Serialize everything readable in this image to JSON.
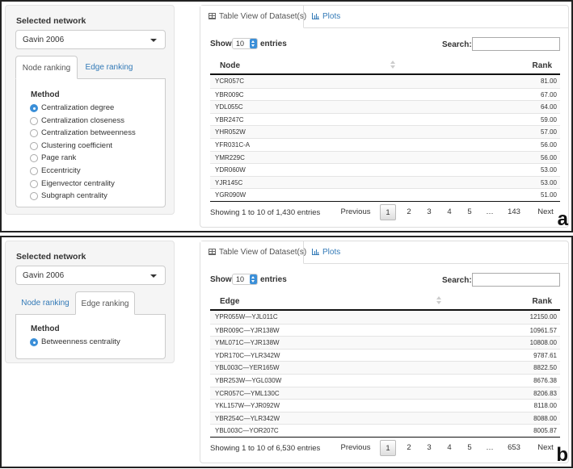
{
  "panel_a": {
    "letter": "a",
    "sidebar": {
      "network_label": "Selected network",
      "network_value": "Gavin 2006",
      "tabs": [
        "Node ranking",
        "Edge ranking"
      ],
      "active_tab": 0,
      "method_label": "Method",
      "methods": [
        {
          "label": "Centralization degree",
          "checked": true
        },
        {
          "label": "Centralization closeness",
          "checked": false
        },
        {
          "label": "Centralization betweenness",
          "checked": false
        },
        {
          "label": "Clustering coefficient",
          "checked": false
        },
        {
          "label": "Page rank",
          "checked": false
        },
        {
          "label": "Eccentricity",
          "checked": false
        },
        {
          "label": "Eigenvector centrality",
          "checked": false
        },
        {
          "label": "Subgraph centrality",
          "checked": false
        }
      ]
    },
    "main": {
      "tabs": [
        "Table View of Dataset(s)",
        "Plots"
      ],
      "show": "Show",
      "length": "10",
      "entries": "entries",
      "search_label": "Search:",
      "search_value": "",
      "columns": [
        "Node",
        "Rank"
      ],
      "rows": [
        [
          "YCR057C",
          "81.00"
        ],
        [
          "YBR009C",
          "67.00"
        ],
        [
          "YDL055C",
          "64.00"
        ],
        [
          "YBR247C",
          "59.00"
        ],
        [
          "YHR052W",
          "57.00"
        ],
        [
          "YFR031C-A",
          "56.00"
        ],
        [
          "YMR229C",
          "56.00"
        ],
        [
          "YDR060W",
          "53.00"
        ],
        [
          "YJR145C",
          "53.00"
        ],
        [
          "YGR090W",
          "51.00"
        ]
      ],
      "info": "Showing 1 to 10 of 1,430 entries",
      "pagination": [
        "Previous",
        "1",
        "2",
        "3",
        "4",
        "5",
        "…",
        "143",
        "Next"
      ]
    }
  },
  "panel_b": {
    "letter": "b",
    "sidebar": {
      "network_label": "Selected network",
      "network_value": "Gavin 2006",
      "tabs": [
        "Node ranking",
        "Edge ranking"
      ],
      "active_tab": 1,
      "method_label": "Method",
      "methods": [
        {
          "label": "Betweenness centrality",
          "checked": true
        }
      ]
    },
    "main": {
      "tabs": [
        "Table View of Dataset(s)",
        "Plots"
      ],
      "show": "Show",
      "length": "10",
      "entries": "entries",
      "search_label": "Search:",
      "search_value": "",
      "columns": [
        "Edge",
        "Rank"
      ],
      "rows": [
        [
          "YPR055W—YJL011C",
          "12150.00"
        ],
        [
          "YBR009C—YJR138W",
          "10961.57"
        ],
        [
          "YML071C—YJR138W",
          "10808.00"
        ],
        [
          "YDR170C—YLR342W",
          "9787.61"
        ],
        [
          "YBL003C—YER165W",
          "8822.50"
        ],
        [
          "YBR253W—YGL030W",
          "8676.38"
        ],
        [
          "YCR057C—YML130C",
          "8206.83"
        ],
        [
          "YKL157W—YJR092W",
          "8118.00"
        ],
        [
          "YBR254C—YLR342W",
          "8088.00"
        ],
        [
          "YBL003C—YOR207C",
          "8005.87"
        ]
      ],
      "info": "Showing 1 to 10 of 6,530 entries",
      "pagination": [
        "Previous",
        "1",
        "2",
        "3",
        "4",
        "5",
        "…",
        "653",
        "Next"
      ]
    }
  }
}
